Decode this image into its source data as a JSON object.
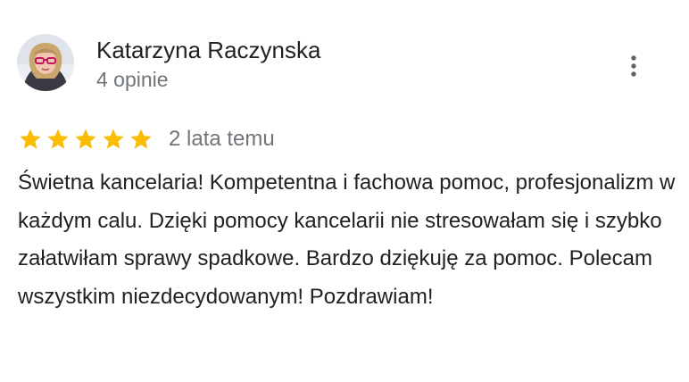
{
  "review": {
    "author_name": "Katarzyna Raczynska",
    "review_count": "4 opinie",
    "rating": 5,
    "rating_max": 5,
    "date": "2 lata temu",
    "text": "Świetna kancelaria! Kompetentna i fachowa pomoc, profesjonalizm w każdym calu. Dzięki pomocy kancelarii nie stresowałam się i szybko załatwiłam sprawy spadkowe. Bardzo dziękuję za pomoc. Polecam wszystkim niezdecydowanym! Pozdrawiam!"
  },
  "icons": {
    "star": "star-icon",
    "menu": "more-vert-icon"
  },
  "colors": {
    "star": "#fbbc04",
    "name": "#202124",
    "secondary": "#70757a",
    "menu": "#5f6368"
  }
}
